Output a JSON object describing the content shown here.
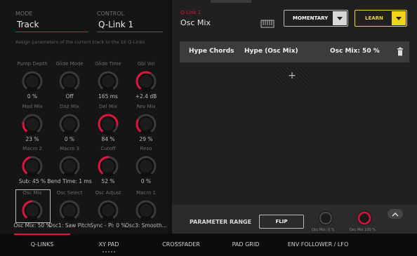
{
  "header": {
    "mode_label": "MODE",
    "mode_value": "Track",
    "control_label": "CONTROL",
    "control_value": "Q-Link 1",
    "description": "Assign parameters of the current track to the 16 Q-Links"
  },
  "knobs": [
    {
      "label": "Pump Depth",
      "value": "0 %",
      "level": 0.0
    },
    {
      "label": "Glide Mode",
      "value": "Off",
      "level": 0.0
    },
    {
      "label": "Glide Time",
      "value": "165 ms",
      "level": 0.0
    },
    {
      "label": "Gbl Vol",
      "value": "+2.4 dB",
      "level": 0.6
    },
    {
      "label": "Mod Mix",
      "value": "23 %",
      "level": 0.23
    },
    {
      "label": "Dist Mix",
      "value": "0 %",
      "level": 0.0
    },
    {
      "label": "Del Mix",
      "value": "84 %",
      "level": 0.84
    },
    {
      "label": "Rev Mix",
      "value": "29 %",
      "level": 0.29
    },
    {
      "label": "Macro 2",
      "value": "Sub: 45 %",
      "level": 0.45
    },
    {
      "label": "Macro 3",
      "value": "Bend Time: 1 ms",
      "level": 0.0
    },
    {
      "label": "Cutoff",
      "value": "52 %",
      "level": 0.52
    },
    {
      "label": "Reso",
      "value": "0 %",
      "level": 0.0
    },
    {
      "label": "Osc Mix",
      "value": "Osc Mix: 50 %",
      "level": 0.5
    },
    {
      "label": "Osc Select",
      "value": "Osc1: Saw Pitch",
      "level": 0.0
    },
    {
      "label": "Osc Adjust",
      "value": "Sync - Pi: 0 %",
      "level": 0.0
    },
    {
      "label": "Macro 1",
      "value": "Osc3: Smooth...",
      "level": 0.0
    }
  ],
  "right": {
    "qlink_label": "Q-Link 1",
    "qlink_param": "Osc Mix",
    "keyboard_icon": "keyboard-icon",
    "mode_button": "MOMENTARY",
    "learn_button": "LEARN",
    "assignment": {
      "col1": "Hype Chords",
      "col2": "Hype (Osc Mix)",
      "col3": "Osc Mix: 50 %"
    },
    "add_symbol": "+",
    "param_range_label": "PARAMETER RANGE",
    "flip_label": "FLIP",
    "min_value": "Osc Mix: 0 %",
    "max_value": "Osc Mix 100 %"
  },
  "tabs": [
    "Q-LINKS",
    "XY PAD",
    "CROSSFADER",
    "PAD GRID",
    "ENV FOLLOWER / LFO"
  ],
  "colors": {
    "accent_red": "#e1123f",
    "accent_yellow": "#f2d21b"
  }
}
